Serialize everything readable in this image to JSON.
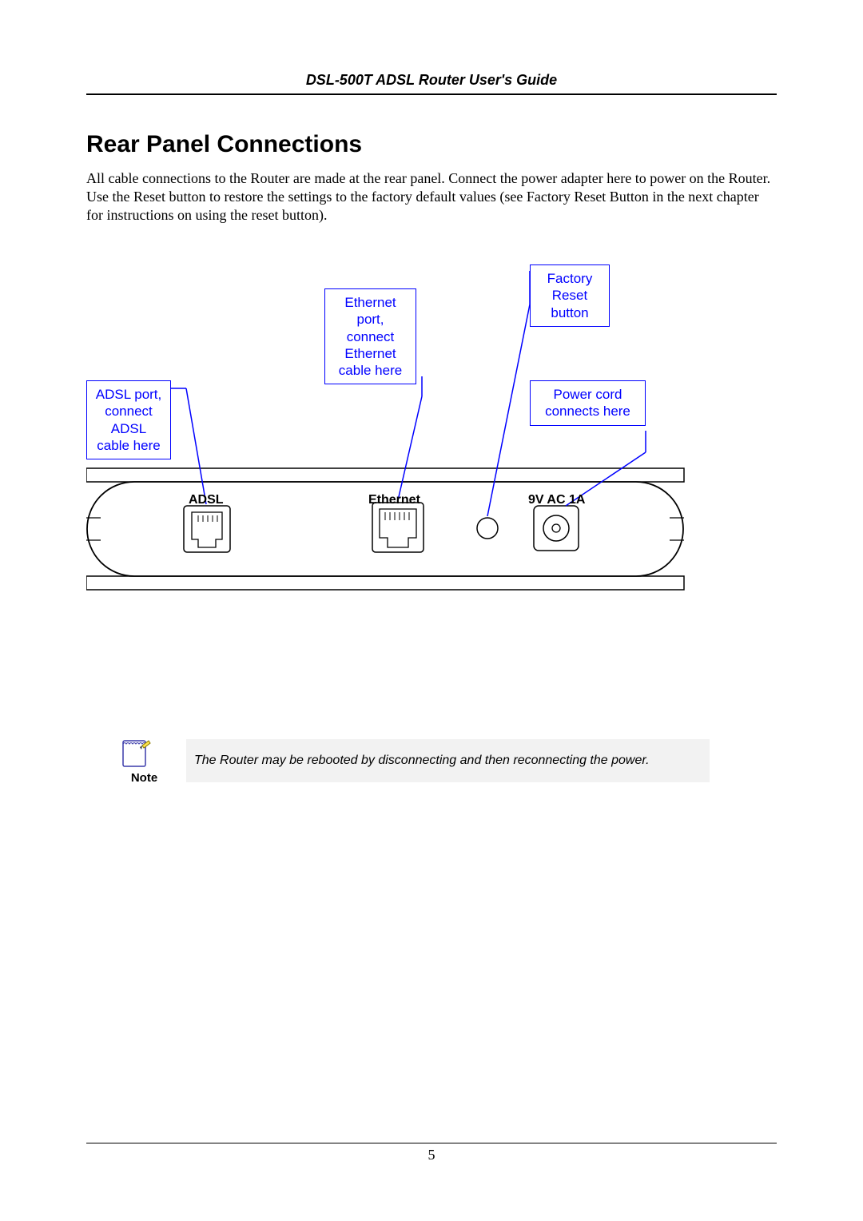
{
  "header": {
    "guide_title": "DSL-500T ADSL Router User's Guide"
  },
  "section": {
    "title": "Rear Panel Connections",
    "body": "All cable connections to the Router are made at the rear panel. Connect the power adapter here to power on the Router. Use the Reset button to restore the settings to the factory default values (see Factory Reset Button in the next chapter for instructions on using the reset button)."
  },
  "diagram": {
    "callouts": {
      "adsl_port": "ADSL port, connect ADSL cable here",
      "ethernet_port": "Ethernet port, connect Ethernet cable here",
      "factory_reset": "Factory Reset button",
      "power_cord": "Power cord connects here"
    },
    "port_labels": {
      "adsl": "ADSL",
      "ethernet": "Ethernet",
      "power": "9V AC 1A"
    }
  },
  "note": {
    "label": "Note",
    "text": "The Router may be rebooted by disconnecting and then reconnecting the power."
  },
  "footer": {
    "page_number": "5"
  }
}
